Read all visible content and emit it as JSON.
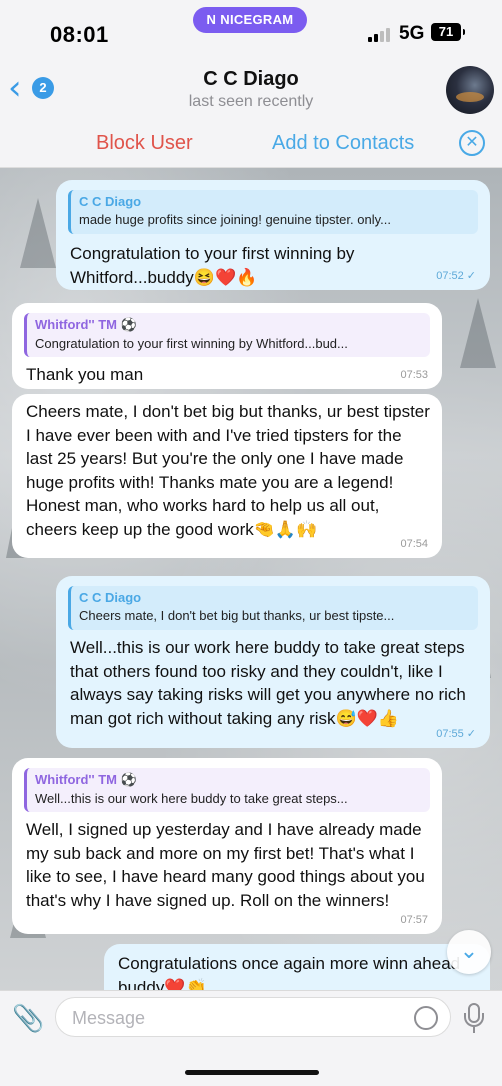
{
  "status_bar": {
    "time": "08:01",
    "pill_label": "NICEGRAM",
    "network": "5G",
    "battery": "71"
  },
  "header": {
    "back_count": "2",
    "title": "C C Diago",
    "subtitle": "last seen recently"
  },
  "actions": {
    "block_label": "Block User",
    "add_label": "Add to Contacts"
  },
  "messages": [
    {
      "direction": "out",
      "reply_name": "C C Diago",
      "reply_text": "made huge profits since joining! genuine tipster. only...",
      "text": "Congratulation to your first winning by Whitford...buddy😆❤️🔥",
      "time": "07:52"
    },
    {
      "direction": "in",
      "reply_name": "Whitford'' TM ⚽",
      "reply_text": "Congratulation to your first winning by Whitford...bud...",
      "text": "Thank you man",
      "time": "07:53"
    },
    {
      "direction": "in",
      "text": "Cheers mate, I don't bet big but thanks, ur best tipster I have ever been with and I've tried tipsters for the last 25 years! But you're the only one I have made huge profits with! Thanks mate you are a legend! Honest man, who works hard to help us all out, cheers keep up the good work🤏🙏🙌",
      "time": "07:54"
    },
    {
      "direction": "out",
      "reply_name": "C C Diago",
      "reply_text": "Cheers mate, I don't bet big but thanks, ur best tipste...",
      "text": "Well...this is our work here buddy to take great steps that others found too risky and they couldn't, like I always say taking risks will get you anywhere no rich man got rich without taking any risk😅❤️👍",
      "time": "07:55"
    },
    {
      "direction": "in",
      "reply_name": "Whitford'' TM ⚽",
      "reply_text": "Well...this is our work here buddy to take great steps...",
      "text": "Well, I signed up yesterday and I have already made my sub back and more on my first bet! That's what I like to see, I have heard many good things about you that's why I have signed up. Roll on the winners!",
      "time": "07:57"
    },
    {
      "direction": "out",
      "text": "Congratulations once again more winn ahead buddy❤️👏"
    }
  ],
  "input": {
    "placeholder": "Message"
  },
  "colors": {
    "accent": "#3a9be6",
    "danger": "#e0544b",
    "nicegram": "#7b5cf0",
    "outgoing_bubble": "#e3f4fe",
    "incoming_bubble": "#ffffff"
  },
  "icons": [
    "chevron-left-icon",
    "paperclip-icon",
    "sticker-icon",
    "microphone-icon",
    "close-circle-icon",
    "chevron-down-icon",
    "signal-icon",
    "battery-icon",
    "double-check-icon"
  ]
}
